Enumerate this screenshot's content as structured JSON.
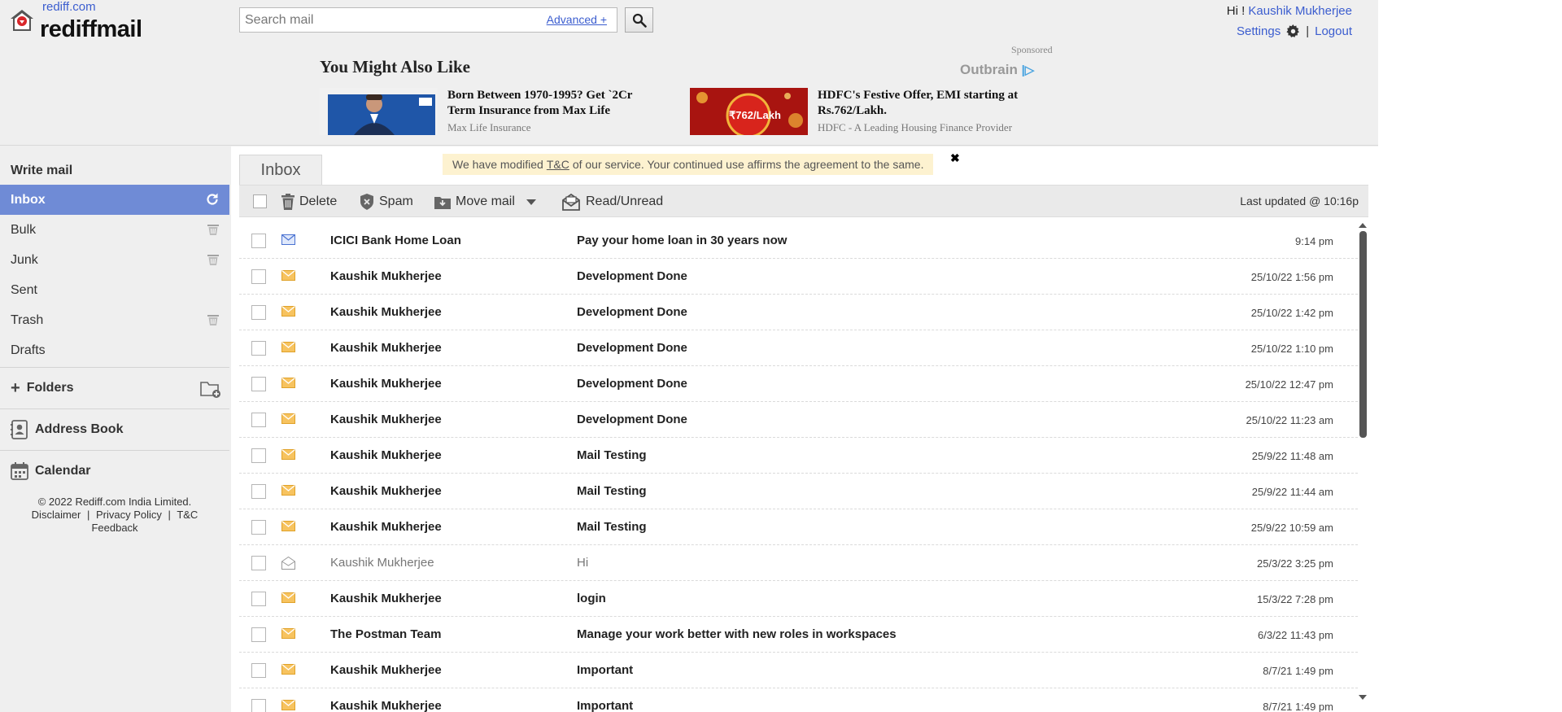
{
  "header": {
    "logo_top": "rediff.com",
    "logo_word": "rediffmail",
    "search_placeholder": "Search mail",
    "advanced_label": "Advanced +",
    "greeting": "Hi !",
    "user_name": "Kaushik Mukherjee",
    "settings_label": "Settings",
    "logout_label": "Logout",
    "separator": "|"
  },
  "ads": {
    "heading": "You Might Also Like",
    "sponsored": "Sponsored",
    "provider": "Outbrain",
    "items": [
      {
        "title": "Born Between 1970-1995? Get `2Cr Term Insurance from Max Life",
        "source": "Max Life Insurance"
      },
      {
        "title": "HDFC's Festive Offer, EMI starting at Rs.762/Lakh.",
        "source": "HDFC - A Leading Housing Finance Provider",
        "thumb_text": "₹762/Lakh"
      }
    ]
  },
  "nav": {
    "write_mail": "Write mail",
    "inbox": "Inbox",
    "bulk": "Bulk",
    "junk": "Junk",
    "sent": "Sent",
    "trash": "Trash",
    "drafts": "Drafts",
    "folders": "Folders",
    "address_book": "Address Book",
    "calendar": "Calendar"
  },
  "footer": {
    "copyright": "© 2022 Rediff.com India Limited.",
    "disclaimer": "Disclaimer",
    "privacy": "Privacy Policy",
    "tc": "T&C",
    "feedback": "Feedback",
    "sep": "|"
  },
  "main": {
    "tab_label": "Inbox",
    "notice_prefix": "We have modified",
    "notice_link": "T&C",
    "notice_suffix": "of our service. Your continued use affirms the agreement to the same.",
    "notice_close": "✖",
    "toolbar": {
      "delete": "Delete",
      "spam": "Spam",
      "move_mail": "Move mail",
      "read_unread": "Read/Unread",
      "last_updated": "Last updated  @ 10:16p"
    }
  },
  "mails": [
    {
      "from": "ICICI Bank Home Loan",
      "subject": "Pay your home loan in 30 years now",
      "date": "9:14 pm",
      "state": "unread",
      "icon": "blue-envelope"
    },
    {
      "from": "Kaushik Mukherjee",
      "subject": "Development Done",
      "date": "25/10/22 1:56 pm",
      "state": "unread",
      "icon": "yellow-envelope"
    },
    {
      "from": "Kaushik Mukherjee",
      "subject": "Development Done",
      "date": "25/10/22 1:42 pm",
      "state": "unread",
      "icon": "yellow-envelope"
    },
    {
      "from": "Kaushik Mukherjee",
      "subject": "Development Done",
      "date": "25/10/22 1:10 pm",
      "state": "unread",
      "icon": "yellow-envelope"
    },
    {
      "from": "Kaushik Mukherjee",
      "subject": "Development Done",
      "date": "25/10/22 12:47 pm",
      "state": "unread",
      "icon": "yellow-envelope"
    },
    {
      "from": "Kaushik Mukherjee",
      "subject": "Development Done",
      "date": "25/10/22 11:23 am",
      "state": "unread",
      "icon": "yellow-envelope"
    },
    {
      "from": "Kaushik Mukherjee",
      "subject": "Mail Testing",
      "date": "25/9/22 11:48 am",
      "state": "unread",
      "icon": "yellow-envelope"
    },
    {
      "from": "Kaushik Mukherjee",
      "subject": "Mail Testing",
      "date": "25/9/22 11:44 am",
      "state": "unread",
      "icon": "yellow-envelope"
    },
    {
      "from": "Kaushik Mukherjee",
      "subject": "Mail Testing",
      "date": "25/9/22 10:59 am",
      "state": "unread",
      "icon": "yellow-envelope"
    },
    {
      "from": "Kaushik Mukherjee",
      "subject": "Hi",
      "date": "25/3/22 3:25 pm",
      "state": "read",
      "icon": "open-envelope"
    },
    {
      "from": "Kaushik Mukherjee",
      "subject": "login",
      "date": "15/3/22 7:28 pm",
      "state": "unread",
      "icon": "yellow-envelope"
    },
    {
      "from": "The Postman Team",
      "subject": "Manage your work better with new roles in workspaces",
      "date": "6/3/22 11:43 pm",
      "state": "unread",
      "icon": "yellow-envelope"
    },
    {
      "from": "Kaushik Mukherjee",
      "subject": "Important",
      "date": "8/7/21 1:49 pm",
      "state": "unread",
      "icon": "yellow-envelope"
    },
    {
      "from": "Kaushik Mukherjee",
      "subject": "Important",
      "date": "8/7/21 1:49 pm",
      "state": "unread",
      "icon": "yellow-envelope"
    }
  ],
  "colors": {
    "accent": "#6f8bd6",
    "link": "#3b5dcf",
    "notice_bg": "#fdf2d0",
    "envelope_yellow": "#f0b43c",
    "envelope_blue": "#4a72d1"
  }
}
